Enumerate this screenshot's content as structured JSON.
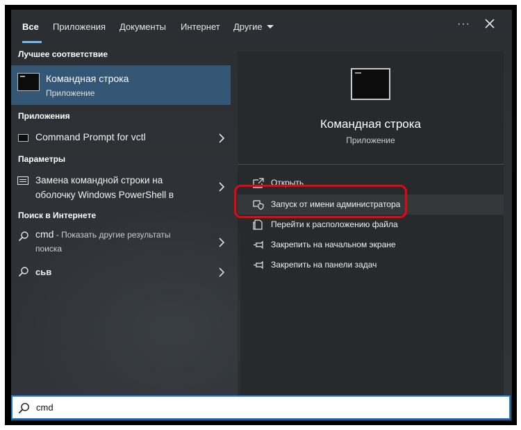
{
  "tabs": [
    {
      "label": "Все",
      "active": true
    },
    {
      "label": "Приложения"
    },
    {
      "label": "Документы"
    },
    {
      "label": "Интернет"
    },
    {
      "label": "Другие"
    }
  ],
  "header": {
    "more_icon": "more-icon",
    "close_icon": "close-icon"
  },
  "best_match": {
    "section_title": "Лучшее соответствие",
    "title": "Командная строка",
    "subtitle": "Приложение",
    "icon": "cmd-icon"
  },
  "apps": {
    "section_title": "Приложения",
    "item": {
      "label": "Command Prompt for vctl",
      "icon": "cmd-icon"
    }
  },
  "settings": {
    "section_title": "Параметры",
    "item": {
      "line1": "Замена командной строки на",
      "line2": "оболочку Windows PowerShell в",
      "icon": "settings-icon"
    }
  },
  "web": {
    "section_title": "Поиск в Интернете",
    "items": [
      {
        "query": "cmd",
        "suffix": " - Показать другие результаты",
        "suffix2": "поиска"
      },
      {
        "query": "сьв"
      }
    ]
  },
  "preview": {
    "title": "Командная строка",
    "subtitle": "Приложение",
    "actions": [
      {
        "label": "Открыть",
        "icon": "open-icon"
      },
      {
        "label": "Запуск от имени администратора",
        "icon": "shield-icon",
        "highlighted": true
      },
      {
        "label": "Перейти к расположению файла",
        "icon": "file-location-icon"
      },
      {
        "label": "Закрепить на начальном экране",
        "icon": "pin-icon"
      },
      {
        "label": "Закрепить на панели задач",
        "icon": "pin-icon"
      }
    ]
  },
  "search": {
    "value": "cmd"
  },
  "colors": {
    "accent": "#76b9ed",
    "highlight_border": "#e30613",
    "selected": "#345776",
    "search_border": "#1f7cd6"
  }
}
